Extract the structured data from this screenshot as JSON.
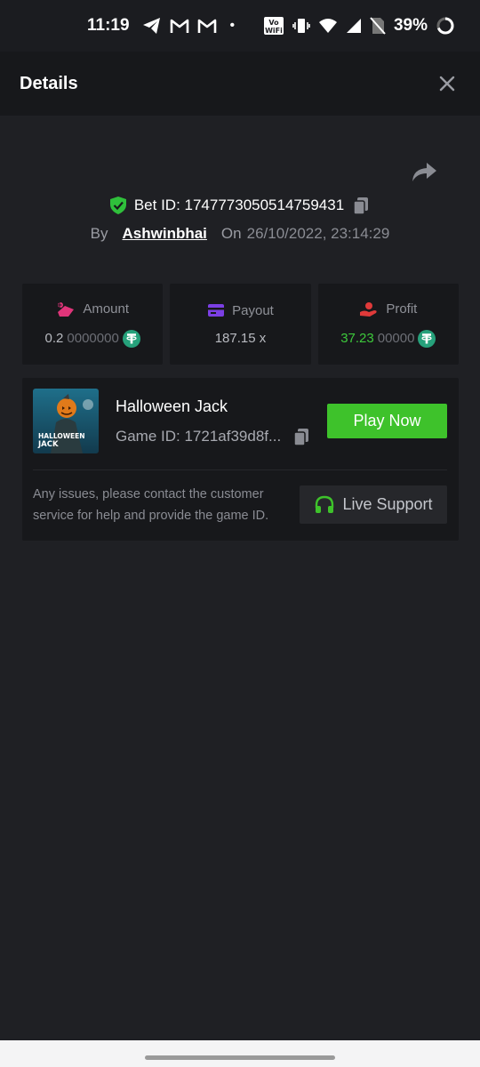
{
  "status_bar": {
    "time": "11:19",
    "dot": "•",
    "vowifi": "Vo WiFi",
    "battery": "39%",
    "icons": [
      "telegram-icon",
      "gmail-icon",
      "gmail-icon",
      "vowifi-icon",
      "vibrate-icon",
      "wifi-icon",
      "signal-icon",
      "no-sim-icon",
      "battery-ring-icon"
    ]
  },
  "header": {
    "title": "Details",
    "close_icon": "close-icon"
  },
  "bet": {
    "bet_id_label": "Bet ID: 1747773050514759431",
    "by_label": "By",
    "username": "Ashwinbhai",
    "on_label": "On",
    "date": "26/10/2022, 23:14:29"
  },
  "stats": {
    "amount": {
      "label": "Amount",
      "value_main": "0.2",
      "value_dim": "0000000",
      "icon": "amount-icon"
    },
    "payout": {
      "label": "Payout",
      "value": "187.15 x",
      "icon": "card-icon"
    },
    "profit": {
      "label": "Profit",
      "value_main": "37.23",
      "value_dim": "00000",
      "icon": "profit-hand-icon"
    }
  },
  "game": {
    "name": "Halloween Jack",
    "game_id": "Game ID: 1721af39d8f...",
    "play_label": "Play Now",
    "thumb_text_1": "HALLOWEEN",
    "thumb_text_2": "JACK",
    "issue_text": "Any issues, please contact the customer service for help and provide the game ID.",
    "support_label": "Live Support"
  },
  "colors": {
    "background": "#1f2024",
    "panel": "#17181b",
    "accent_green": "#3ec22b",
    "tether": "#26a17b"
  }
}
